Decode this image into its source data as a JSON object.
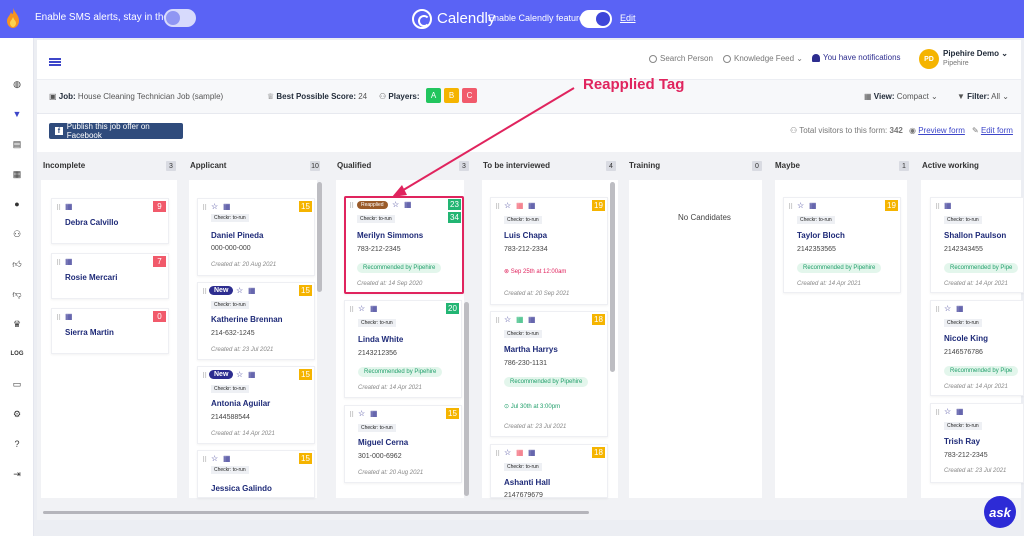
{
  "banner": {
    "sms_text": "Enable SMS alerts, stay in the loop",
    "calendly_name": "Calendly",
    "calendly_enable": "Enable Calendly feature",
    "edit": "Edit"
  },
  "topbar": {
    "search_person": "Search Person",
    "knowledge_feed": "Knowledge Feed",
    "notifications": "You have notifications",
    "avatar_initials": "PD",
    "user_name": "Pipehire Demo",
    "user_org": "Pipehire"
  },
  "filterbar": {
    "job_label": "Job:",
    "job_value": "House Cleaning Technician Job (sample)",
    "score_label": "Best Possible Score:",
    "score_value": "24",
    "players_label": "Players:",
    "players": [
      {
        "label": "A",
        "color": "#22c55e"
      },
      {
        "label": "B",
        "color": "#f5b400"
      },
      {
        "label": "C",
        "color": "#f15a6b"
      }
    ],
    "view_label": "View:",
    "view_value": "Compact",
    "filter_label": "Filter:",
    "filter_value": "All"
  },
  "subbar": {
    "fb_button": "Publish this job offer on Facebook",
    "total_visitors": "Total visitors to this form:",
    "total_visitors_count": "342",
    "preview_form": "Preview form",
    "edit_form": "Edit form"
  },
  "columns": [
    {
      "title": "Incomplete",
      "count": "3"
    },
    {
      "title": "Applicant",
      "count": "10"
    },
    {
      "title": "Qualified",
      "count": "3"
    },
    {
      "title": "To be interviewed",
      "count": "4"
    },
    {
      "title": "Training",
      "count": "0",
      "empty": "No Candidates"
    },
    {
      "title": "Maybe",
      "count": "1"
    },
    {
      "title": "Active working",
      "count": ""
    }
  ],
  "incomplete_cards": [
    {
      "name": "Debra Calvillo",
      "score": "9"
    },
    {
      "name": "Rosie Mercari",
      "score": "7"
    },
    {
      "name": "Sierra Martin",
      "score": "0"
    }
  ],
  "applicant_cards": [
    {
      "name": "Daniel Pineda",
      "phone": "000-000-000",
      "created": "Created at: 20 Aug 2021",
      "score": "15",
      "checkr": "Checkr: to-run"
    },
    {
      "name": "Katherine Brennan",
      "phone": "214-632-1245",
      "created": "Created at: 23 Jul 2021",
      "score": "15",
      "checkr": "Checkr: to-run",
      "tag": "New"
    },
    {
      "name": "Antonia Aguilar",
      "phone": "2144588544",
      "created": "Created at: 14 Apr 2021",
      "score": "15",
      "checkr": "Checkr: to-run",
      "tag": "New"
    },
    {
      "name": "Jessica Galindo",
      "score": "15",
      "checkr": "Checkr: to-run"
    }
  ],
  "qualified_cards": [
    {
      "name": "Merilyn Simmons",
      "phone": "783-212-2345",
      "created": "Created at: 14 Sep 2020",
      "score": "23",
      "score2": "34",
      "checkr": "Checkr: to-run",
      "tag": "Reapplied",
      "rec": "Recommended by Pipehire"
    },
    {
      "name": "Linda White",
      "phone": "2143212356",
      "created": "Created at: 14 Apr 2021",
      "score": "20",
      "checkr": "Checkr: to-run",
      "rec": "Recommended by Pipehire"
    },
    {
      "name": "Miguel Cerna",
      "phone": "301-000-6962",
      "created": "Created at: 20 Aug 2021",
      "score": "15",
      "checkr": "Checkr: to-run"
    }
  ],
  "interview_cards": [
    {
      "name": "Luis Chapa",
      "phone": "783-212-2334",
      "created": "Created at: 20 Sep 2021",
      "score": "19",
      "checkr": "Checkr: to-run",
      "event": "Sep 25th at 12:00am"
    },
    {
      "name": "Martha Harrys",
      "phone": "786-230-1131",
      "created": "Created at: 23 Jul 2021",
      "score": "18",
      "checkr": "Checkr: to-run",
      "rec": "Recommended by Pipehire",
      "event": "Jul 30th at 3:00pm"
    },
    {
      "name": "Ashanti Hall",
      "phone": "2147679679",
      "score": "18",
      "checkr": "Checkr: to-run"
    }
  ],
  "maybe_cards": [
    {
      "name": "Taylor Bloch",
      "phone": "2142353565",
      "created": "Created at: 14 Apr 2021",
      "score": "19",
      "checkr": "Checkr: to-run",
      "rec": "Recommended by Pipehire"
    }
  ],
  "active_cards": [
    {
      "name": "Shallon Paulson",
      "phone": "2142343455",
      "created": "Created at: 14 Apr 2021",
      "checkr": "Checkr: to-run",
      "rec": "Recommended by Pipe"
    },
    {
      "name": "Nicole King",
      "phone": "2146576786",
      "created": "Created at: 14 Apr 2021",
      "checkr": "Checkr: to-run",
      "rec": "Recommended by Pipe"
    },
    {
      "name": "Trish Ray",
      "phone": "783-212-2345",
      "created": "Created at: 23 Jul 2021",
      "checkr": "Checkr: to-run"
    }
  ],
  "annotation": {
    "label": "Reapplied Tag"
  },
  "ask_button": "ask",
  "colors": {
    "brand": "#5a63f5",
    "score_red": "#f15a6b",
    "score_yellow": "#f5b400",
    "score_green": "#22b573",
    "highlight": "#e0245e"
  }
}
